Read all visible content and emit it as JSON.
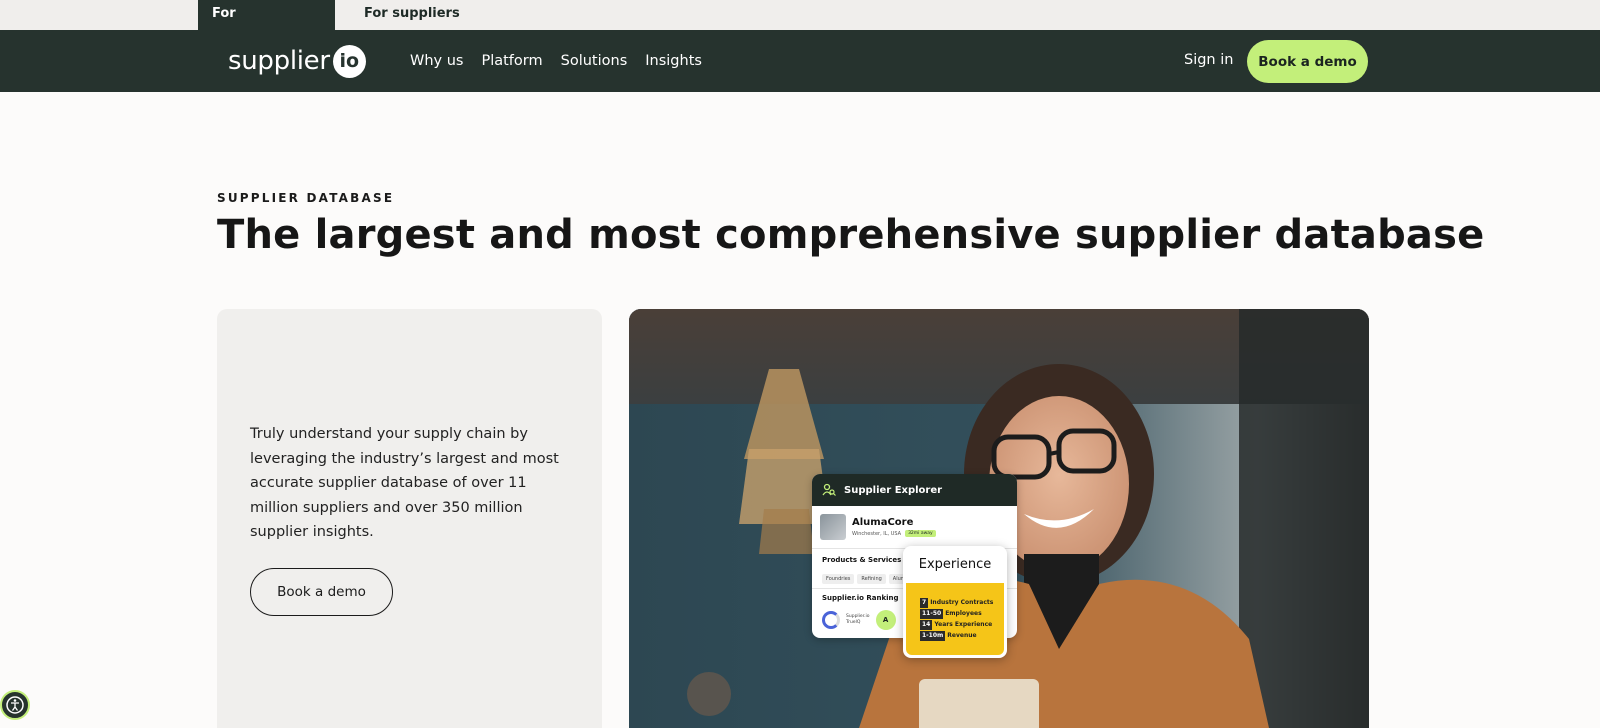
{
  "audience_tabs": [
    {
      "label": "For procurement",
      "active": true
    },
    {
      "label": "For suppliers",
      "active": false
    }
  ],
  "nav": {
    "logo_text": "supplier",
    "logo_badge": "io",
    "links": [
      "Why us",
      "Platform",
      "Solutions",
      "Insights"
    ],
    "sign_in": "Sign in",
    "cta": "Book a demo"
  },
  "hero": {
    "eyebrow": "SUPPLIER DATABASE",
    "headline": "The largest and most comprehensive supplier database",
    "body": "Truly understand your supply chain by leveraging the industry’s largest and most accurate supplier database of over 11 million suppliers and over 350 million supplier insights.",
    "cta": "Book a demo"
  },
  "explorer_card": {
    "title": "Supplier Explorer",
    "company": "AlumaCore",
    "location": "Winchester, IL, USA",
    "distance": "32mi away",
    "products_heading": "Products & Services",
    "tags": [
      "Foundries",
      "Refining",
      "Alumi"
    ],
    "ranking_heading": "Supplier.io Ranking",
    "ranking_label_1": "Supplier.io",
    "ranking_label_2": "TrueIQ",
    "grade": "A"
  },
  "experience_card": {
    "title": "Experience",
    "rows": [
      {
        "value": "7",
        "label": "Industry Contracts"
      },
      {
        "value": "11-50",
        "label": "Employees"
      },
      {
        "value": "14",
        "label": "Years Experience"
      },
      {
        "value": "1-10m",
        "label": "Revenue"
      }
    ]
  },
  "colors": {
    "nav_bg": "#26332e",
    "accent_green": "#c3ef7a",
    "accent_yellow": "#f5c518",
    "page_bg": "#fcfbfa",
    "card_bg": "#f0efed"
  }
}
